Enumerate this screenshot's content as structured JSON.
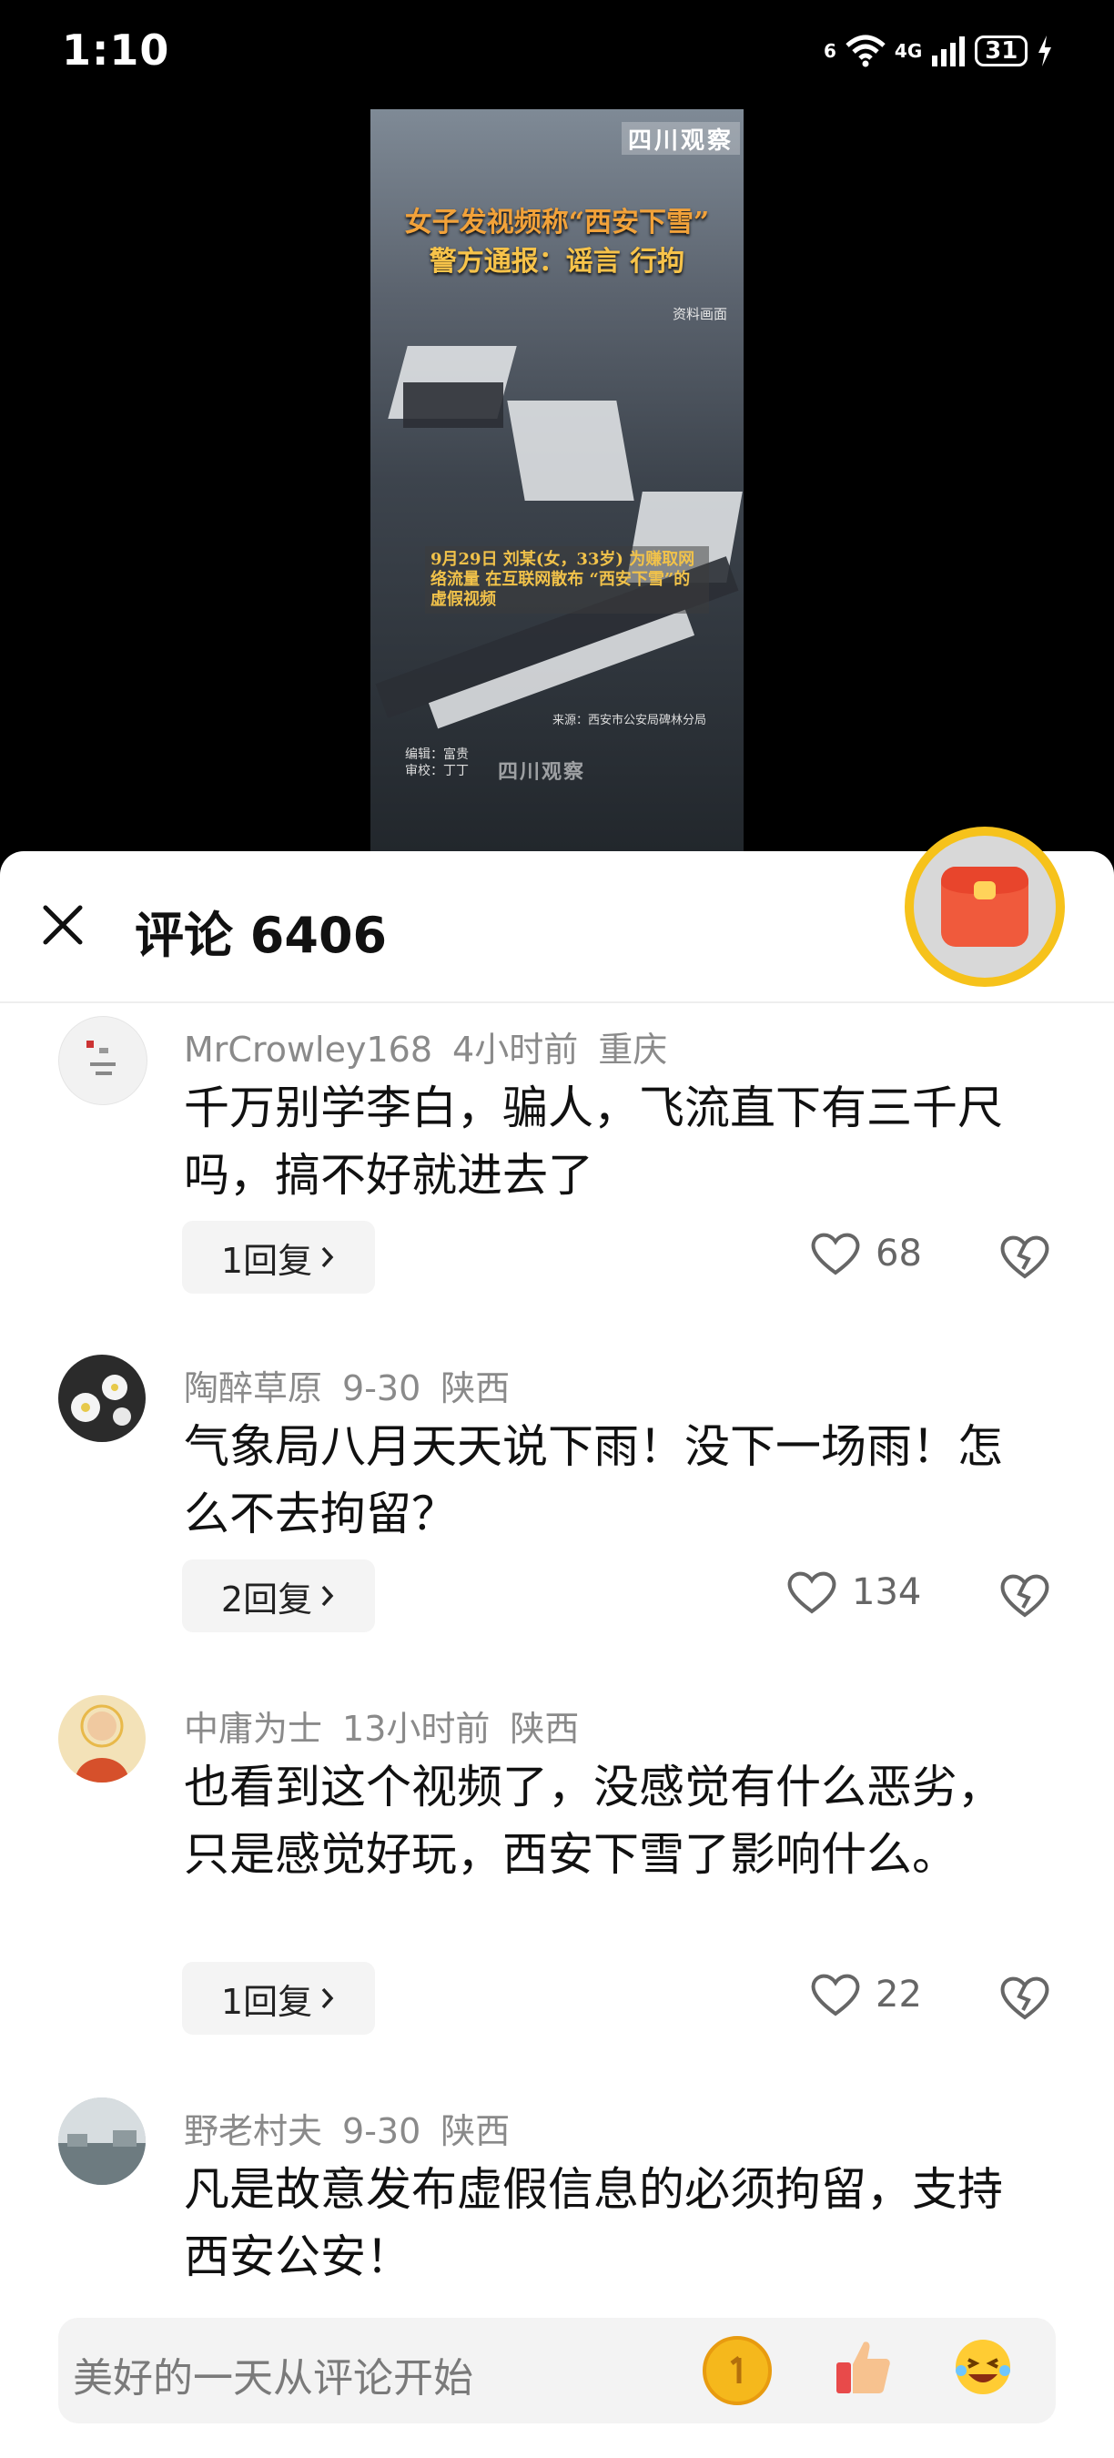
{
  "status": {
    "time": "1:10",
    "battery": "31",
    "network": "4G",
    "sim": "6"
  },
  "video": {
    "logo": "四川观察",
    "headline_1": "女子发视频称“西安下雪”",
    "headline_2": "警方通报：谣言 行拘",
    "small": "资料画面",
    "caption": "9月29日 刘某(女，33岁) 为赚取网络流量 在互联网散布 “西安下雪”的虚假视频",
    "source": "来源：西安市公安局碑林分局",
    "credit_1": "编辑：富贵",
    "credit_2": "审校：丁丁",
    "mark": "四川观察"
  },
  "sheet": {
    "title": "评论 6406"
  },
  "comments": [
    {
      "user": "MrCrowley168",
      "time": "4小时前",
      "location": "重庆",
      "text": "千万别学李白，骗人，飞流直下有三千尺吗，搞不好就进去了",
      "replies": "1回复",
      "likes": "68"
    },
    {
      "user": "陶醉草原",
      "time": "9-30",
      "location": "陕西",
      "text": "气象局八月天天说下雨！没下一场雨！怎么不去拘留？",
      "replies": "2回复",
      "likes": "134"
    },
    {
      "user": "中庸为士",
      "time": "13小时前",
      "location": "陕西",
      "text": "也看到这个视频了，没感觉有什么恶劣，只是感觉好玩，西安下雪了影响什么。",
      "replies": "1回复",
      "likes": "22"
    },
    {
      "user": "野老村夫",
      "time": "9-30",
      "location": "陕西",
      "text": "凡是故意发布虚假信息的必须拘留，支持西安公安！"
    }
  ],
  "input": {
    "placeholder": "美好的一天从评论开始"
  },
  "icons": [
    "close-icon",
    "red-packet-icon",
    "heart-icon",
    "dislike-icon",
    "chevron-right-icon",
    "medal-emoji-icon",
    "thumbs-up-emoji-icon",
    "laughing-emoji-icon"
  ]
}
